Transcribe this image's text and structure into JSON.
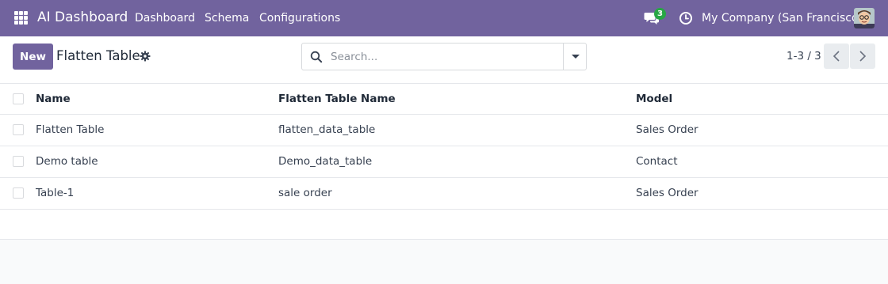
{
  "navbar": {
    "brand": "AI Dashboard",
    "menu": [
      "Dashboard",
      "Schema",
      "Configurations"
    ],
    "chat_badge": "3",
    "company": "My Company (San Francisco)",
    "bg_color": "#71639e"
  },
  "control_panel": {
    "new_label": "New",
    "title": "Flatten Table",
    "search_placeholder": "Search...",
    "pager": "1-3 / 3"
  },
  "table": {
    "headers": [
      "Name",
      "Flatten Table Name",
      "Model"
    ],
    "rows": [
      [
        "Flatten Table",
        "flatten_data_table",
        "Sales Order"
      ],
      [
        "Demo table",
        "Demo_data_table",
        "Contact"
      ],
      [
        "Table-1",
        "sale order",
        "Sales Order"
      ]
    ]
  },
  "icons": {
    "apps": "apps-grid-icon",
    "chat": "chat-icon",
    "activity": "clock-icon",
    "settings": "gear-icon",
    "search": "search-icon",
    "prev": "chevron-left-icon",
    "next": "chevron-right-icon"
  }
}
